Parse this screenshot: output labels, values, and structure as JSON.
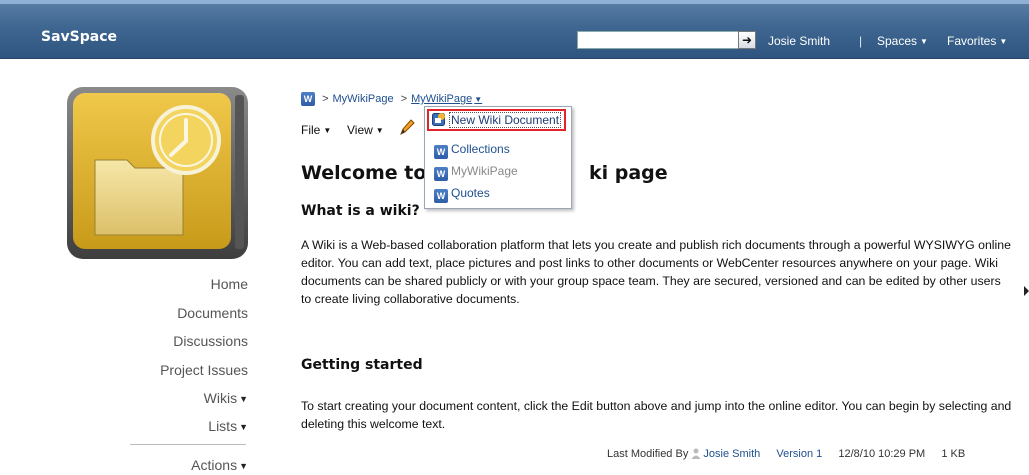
{
  "app": {
    "title": "SavSpace"
  },
  "header": {
    "search_placeholder": "",
    "user": "Josie Smith",
    "separator": "|",
    "spaces_label": "Spaces",
    "favorites_label": "Favorites"
  },
  "sidebar": {
    "items": [
      {
        "label": "Home",
        "has_menu": false
      },
      {
        "label": "Documents",
        "has_menu": false
      },
      {
        "label": "Discussions",
        "has_menu": false
      },
      {
        "label": "Project Issues",
        "has_menu": false
      },
      {
        "label": "Wikis",
        "has_menu": true
      },
      {
        "label": "Lists",
        "has_menu": true
      },
      {
        "label": "Actions",
        "has_menu": true
      }
    ]
  },
  "breadcrumb": {
    "sep": ">",
    "items": [
      "MyWikiPage",
      "MyWikiPage"
    ]
  },
  "toolbar": {
    "file_label": "File",
    "view_label": "View"
  },
  "dropdown": {
    "items": [
      {
        "label": "New Wiki Document",
        "state": "highlighted"
      },
      {
        "label": "Collections",
        "state": "normal"
      },
      {
        "label": "MyWikiPage",
        "state": "disabled"
      },
      {
        "label": "Quotes",
        "state": "normal"
      }
    ]
  },
  "content": {
    "heading_part1": "Welcome to",
    "heading_part2": "ki page",
    "what_is_title": "What is a wiki?",
    "what_is_body": "A Wiki is a Web-based collaboration platform that lets you create and publish rich documents through a powerful WYSIWYG online editor. You can add text, place pictures and post links to other documents or WebCenter resources anywhere on your page. Wiki documents can be shared publicly or with your group space team. They are secured, versioned and can be edited by other users to create living collaborative documents.",
    "getting_started_title": "Getting started",
    "getting_started_body": "To start creating your document content, click the Edit button above and jump into the online editor. You can begin by selecting and deleting this welcome text."
  },
  "footer": {
    "modified_label": "Last Modified By",
    "modified_by": "Josie Smith",
    "version": "Version 1",
    "timestamp": "12/8/10 10:29 PM",
    "size": "1 KB"
  },
  "colors": {
    "topbar": "#3f6791",
    "link": "#1f4f8f",
    "highlight_border": "#e0242a",
    "logo_yellow": "#e2b52c"
  }
}
